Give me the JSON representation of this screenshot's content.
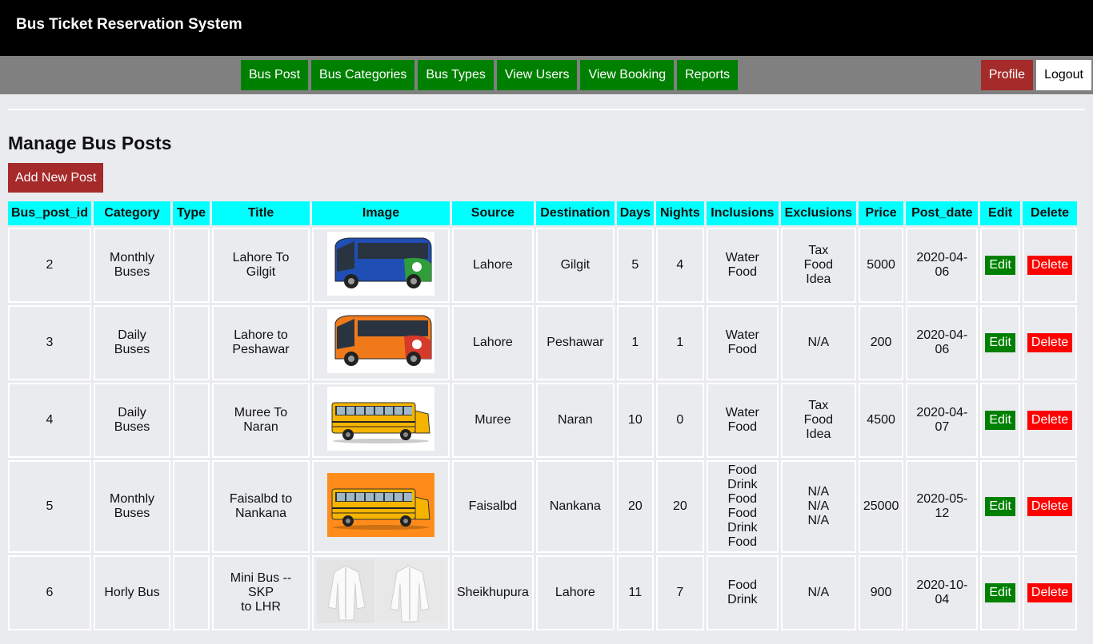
{
  "app": {
    "title": "Bus Ticket Reservation System"
  },
  "nav": {
    "items": [
      {
        "label": "Bus Post"
      },
      {
        "label": "Bus Categories"
      },
      {
        "label": "Bus Types"
      },
      {
        "label": "View Users"
      },
      {
        "label": "View Booking"
      },
      {
        "label": "Reports"
      }
    ],
    "profile": "Profile",
    "logout": "Logout"
  },
  "page": {
    "title": "Manage Bus Posts",
    "add_button": "Add New Post"
  },
  "table": {
    "headers": [
      "Bus_post_id",
      "Category",
      "Type",
      "Title",
      "Image",
      "Source",
      "Destination",
      "Days",
      "Nights",
      "Inclusions",
      "Exclusions",
      "Price",
      "Post_date",
      "Edit",
      "Delete"
    ],
    "edit_label": "Edit",
    "delete_label": "Delete",
    "rows": [
      {
        "id": "2",
        "category": [
          "Monthly",
          "Buses"
        ],
        "type": "",
        "title": [
          "Lahore To Gilgit"
        ],
        "image": "bus-blue-green",
        "source": "Lahore",
        "destination": "Gilgit",
        "days": "5",
        "nights": "4",
        "inclusions": [
          "Water",
          "Food"
        ],
        "exclusions": [
          "Tax",
          "Food",
          "Idea"
        ],
        "price": "5000",
        "post_date": [
          "2020-04-",
          "06"
        ]
      },
      {
        "id": "3",
        "category": [
          "Daily Buses"
        ],
        "type": "",
        "title": [
          "Lahore to",
          "Peshawar"
        ],
        "image": "bus-orange",
        "source": "Lahore",
        "destination": "Peshawar",
        "days": "1",
        "nights": "1",
        "inclusions": [
          "Water",
          "Food"
        ],
        "exclusions": [
          "N/A"
        ],
        "price": "200",
        "post_date": [
          "2020-04-",
          "06"
        ]
      },
      {
        "id": "4",
        "category": [
          "Daily Buses"
        ],
        "type": "",
        "title": [
          "Muree To",
          "Naran"
        ],
        "image": "school-bus",
        "source": "Muree",
        "destination": "Naran",
        "days": "10",
        "nights": "0",
        "inclusions": [
          "Water",
          "Food"
        ],
        "exclusions": [
          "Tax",
          "Food",
          "Idea"
        ],
        "price": "4500",
        "post_date": [
          "2020-04-",
          "07"
        ]
      },
      {
        "id": "5",
        "category": [
          "Monthly",
          "Buses"
        ],
        "type": "",
        "title": [
          "Faisalbd to",
          "Nankana"
        ],
        "image": "school-bus-orange-bg",
        "source": "Faisalbd",
        "destination": "Nankana",
        "days": "20",
        "nights": "20",
        "inclusions": [
          "Food",
          "Drink",
          "Food",
          "Food",
          "Drink",
          "Food"
        ],
        "exclusions": [
          "N/A",
          "N/A",
          "N/A"
        ],
        "price": "25000",
        "post_date": [
          "2020-05-",
          "12"
        ]
      },
      {
        "id": "6",
        "category": [
          "Horly Bus"
        ],
        "type": "",
        "title": [
          "Mini Bus -- SKP",
          "to LHR"
        ],
        "image": "white-shirts",
        "source": "Sheikhupura",
        "destination": "Lahore",
        "days": "11",
        "nights": "7",
        "inclusions": [
          "Food",
          "Drink"
        ],
        "exclusions": [
          "N/A"
        ],
        "price": "900",
        "post_date": [
          "2020-10-",
          "04"
        ]
      }
    ]
  }
}
